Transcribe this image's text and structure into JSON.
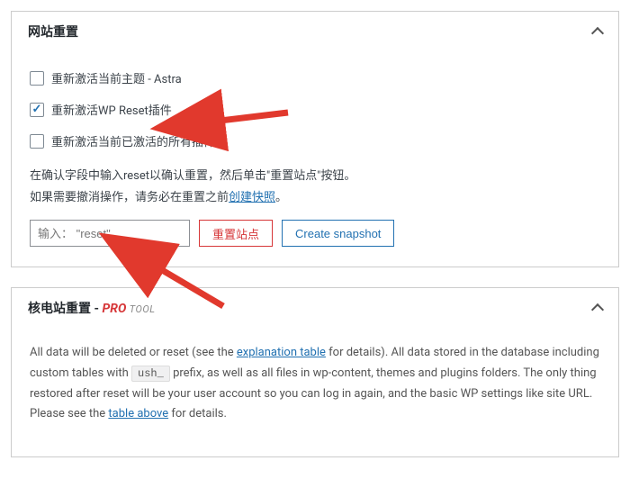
{
  "panel1": {
    "title": "网站重置",
    "checkboxes": [
      {
        "label": "重新激活当前主题 - Astra",
        "checked": false
      },
      {
        "label": "重新激活WP Reset插件",
        "checked": true
      },
      {
        "label": "重新激活当前已激活的所有插件",
        "checked": false
      }
    ],
    "desc_line1_a": "在确认字段中输入reset以确认重置，然后单击\"重置站点\"按钮。",
    "desc_line2_a": "如果需要撤消操作，请务必在重置之前",
    "desc_line2_link": "创建快照",
    "desc_line2_b": "。",
    "input_placeholder": "输入： \"reset\"",
    "btn_reset": "重置站点",
    "btn_snapshot": "Create snapshot"
  },
  "panel2": {
    "title": "核电站重置",
    "pro": "PRO",
    "tool": "TOOL",
    "body_a": "All data will be deleted or reset (see the ",
    "body_link1": "explanation table",
    "body_b": " for details). All data stored in the database including custom tables with ",
    "prefix": "ush_",
    "body_c": " prefix, as well as all files in wp-content, themes and plugins folders. The only thing restored after reset will be your user account so you can log in again, and the basic WP settings like site URL. Please see the ",
    "body_link2": "table above",
    "body_d": " for details."
  },
  "colors": {
    "danger": "#d63638",
    "link": "#2271b1",
    "arrow": "#e1392d"
  }
}
